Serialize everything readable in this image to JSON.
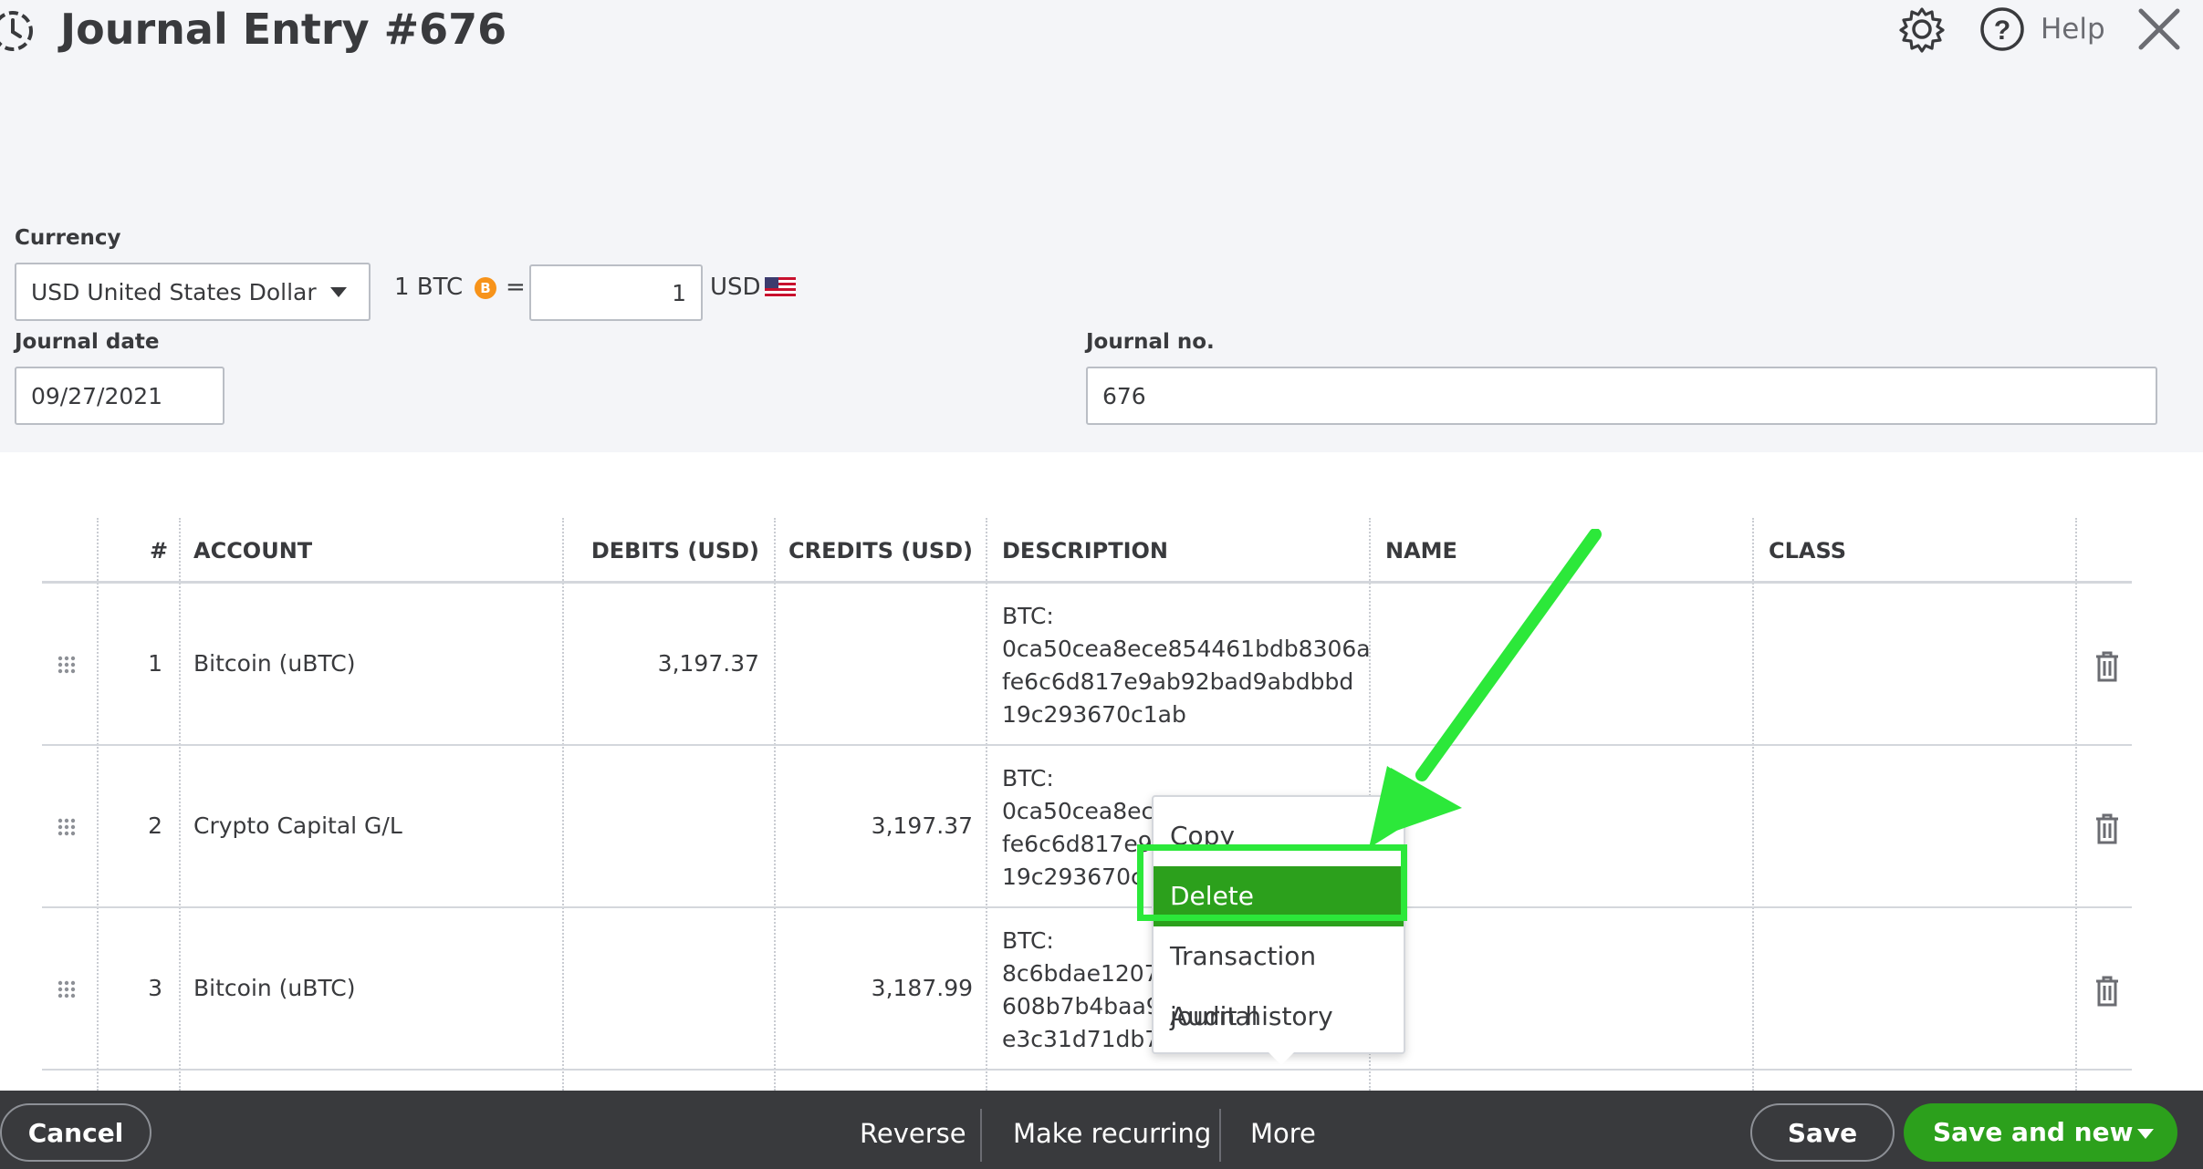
{
  "header": {
    "title": "Journal Entry #676",
    "help_label": "Help"
  },
  "form": {
    "currency_label": "Currency",
    "currency_value": "USD United States Dollar",
    "rate_prefix": "1 BTC",
    "btc_symbol": "B",
    "rate_equals": "=",
    "rate_value": "1",
    "rate_suffix": "USD",
    "journal_date_label": "Journal date",
    "journal_date_value": "09/27/2021",
    "journal_no_label": "Journal no.",
    "journal_no_value": "676"
  },
  "table": {
    "headers": {
      "num": "#",
      "account": "ACCOUNT",
      "debits": "DEBITS (USD)",
      "credits": "CREDITS (USD)",
      "description": "DESCRIPTION",
      "name": "NAME",
      "class": "CLASS"
    },
    "rows": [
      {
        "num": "1",
        "account": "Bitcoin (uBTC)",
        "debits": "3,197.37",
        "credits": "",
        "description": "BTC:\n0ca50cea8ece854461bdb8306a\nfe6c6d817e9ab92bad9abdbbd\n19c293670c1ab"
      },
      {
        "num": "2",
        "account": "Crypto Capital G/L",
        "debits": "",
        "credits": "3,197.37",
        "description": "BTC:\n0ca50cea8ece\nfe6c6d817e9\n19c293670c"
      },
      {
        "num": "3",
        "account": "Bitcoin (uBTC)",
        "debits": "",
        "credits": "3,187.99",
        "description": "BTC:\n8c6bdae1207\n608b7b4baa9\ne3c31d71db7"
      }
    ]
  },
  "context_menu": {
    "items": [
      "Copy",
      "Delete",
      "Transaction journal",
      "Audit history"
    ],
    "active_index": 1
  },
  "footer": {
    "cancel": "Cancel",
    "reverse": "Reverse",
    "make_recurring": "Make recurring",
    "more": "More",
    "save": "Save",
    "save_and_new": "Save and new"
  },
  "colors": {
    "accent_green": "#2ca01c",
    "annotation_green": "#2ce83a",
    "footer_bg": "#393a3d",
    "header_bg": "#f4f5f8"
  }
}
